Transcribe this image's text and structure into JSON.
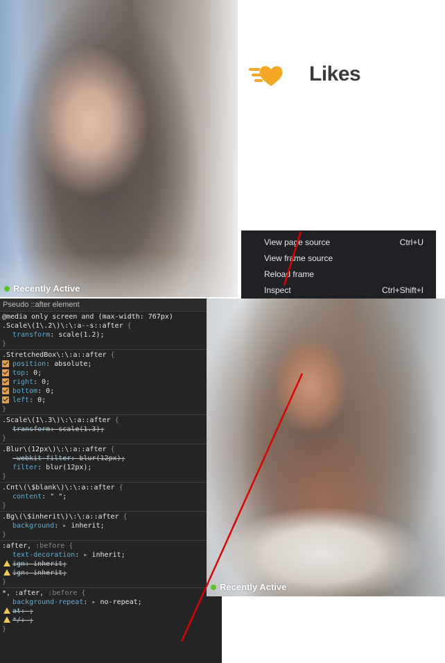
{
  "top_photo": {
    "status": "Recently Active"
  },
  "likes": {
    "title": "Likes",
    "icon": "speed-heart-icon",
    "icon_color": "#f5a623"
  },
  "context_menu": {
    "items": [
      {
        "label": "View page source",
        "shortcut": "Ctrl+U"
      },
      {
        "label": "View frame source",
        "shortcut": ""
      },
      {
        "label": "Reload frame",
        "shortcut": ""
      },
      {
        "label": "Inspect",
        "shortcut": "Ctrl+Shift+I"
      }
    ]
  },
  "devtools": {
    "header": "Pseudo ::after element",
    "rules": [
      {
        "media": "@media only screen and (max-width: 767px)",
        "selector": ".Scale\\(1\\.2\\)\\:\\:a--s::after",
        "declarations": [
          {
            "prop": "transform",
            "val": "scale(1.2);",
            "strike": false
          }
        ]
      },
      {
        "selector": ".StretchedBox\\:\\:a::after",
        "declarations": [
          {
            "prop": "position",
            "val": "absolute;",
            "checked": true
          },
          {
            "prop": "top",
            "val": "0;",
            "checked": true
          },
          {
            "prop": "right",
            "val": "0;",
            "checked": true
          },
          {
            "prop": "bottom",
            "val": "0;",
            "checked": true
          },
          {
            "prop": "left",
            "val": "0;",
            "checked": true
          }
        ]
      },
      {
        "selector": ".Scale\\(1\\.3\\)\\:\\:a::after",
        "declarations": [
          {
            "prop": "transform",
            "val": "scale(1.3);",
            "strike": true
          }
        ]
      },
      {
        "selector": ".Blur\\(12px\\)\\:\\:a::after",
        "declarations": [
          {
            "prop": "-webkit-filter",
            "val": "blur(12px);",
            "strike": true
          },
          {
            "prop": "filter",
            "val": "blur(12px);",
            "strike": false
          }
        ]
      },
      {
        "selector": ".Cnt\\(\\$blank\\)\\:\\:a::after",
        "declarations": [
          {
            "prop": "content",
            "val": "\" \";",
            "strike": false
          }
        ]
      },
      {
        "selector": ".Bg\\(\\$inherit\\)\\:\\:a::after",
        "declarations": [
          {
            "prop": "background",
            "val": "inherit;",
            "strike": false
          }
        ]
      },
      {
        "selector": ":after,",
        "selector_dim": ":before",
        "declarations": [
          {
            "prop": "text-decoration",
            "val": "inherit;",
            "strike": false
          },
          {
            "prop": "ign",
            "val": "inherit;",
            "strike": true,
            "warn": true
          },
          {
            "prop": "ign",
            "val": "inherit;",
            "strike": true,
            "warn": true
          }
        ]
      },
      {
        "selector": "*, :after,",
        "selector_dim": ":before",
        "declarations": [
          {
            "prop": "background-repeat",
            "val": "no-repeat;",
            "strike": false
          },
          {
            "prop": "at",
            "val": ";",
            "strike": true,
            "warn": true
          },
          {
            "prop": "*/",
            "val": ";",
            "strike": true,
            "warn": true
          }
        ]
      }
    ]
  },
  "bottom_photo": {
    "status": "Recently Active"
  },
  "colors": {
    "annotation_line": "#e00000",
    "active_dot": "#58c322",
    "checkbox": "#e3a04a",
    "devtools_bg": "#242424"
  }
}
